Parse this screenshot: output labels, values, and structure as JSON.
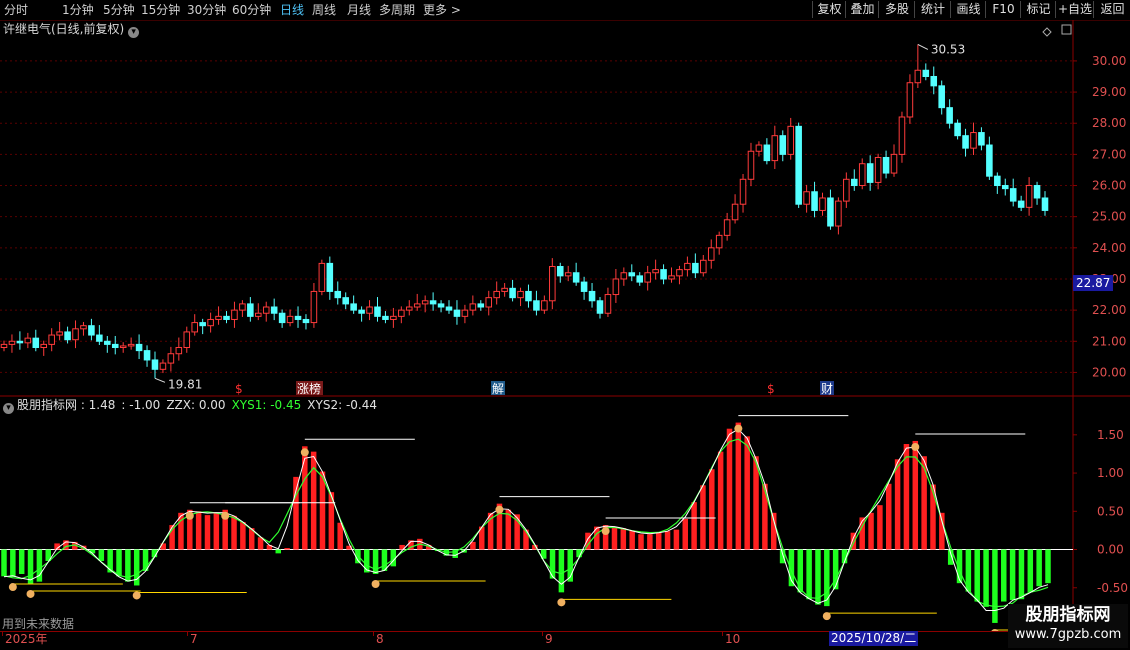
{
  "toolbar": {
    "periods": [
      "分时",
      "1分钟",
      "5分钟",
      "15分钟",
      "30分钟",
      "60分钟",
      "日线",
      "周线",
      "月线",
      "多周期",
      "更多 >"
    ],
    "active_period": "日线",
    "right_buttons": [
      "复权",
      "叠加",
      "多股",
      "统计",
      "画线",
      "F10",
      "标记",
      "+自选",
      "返回"
    ]
  },
  "main_chart": {
    "stock_title": "许继电气(日线,前复权)",
    "collapse_icon": "chevron-down-icon",
    "settings_icons": [
      "diamond-icon",
      "window-icon"
    ],
    "price_ticks": [
      "30.00",
      "29.00",
      "28.00",
      "27.00",
      "26.00",
      "25.00",
      "24.00",
      "23.00",
      "22.00",
      "21.00",
      "20.00"
    ],
    "current_price": "22.87",
    "high_marker": "30.53",
    "low_marker": "19.81",
    "event_markers": [
      {
        "label": "$",
        "color": "#ff3030"
      },
      {
        "label": "涨榜",
        "color": "#ffffff",
        "bg": "#7a1a1a"
      },
      {
        "label": "解",
        "color": "#ffffff",
        "bg": "#1e5a8a"
      },
      {
        "label": "$",
        "color": "#ff3030"
      },
      {
        "label": "财",
        "color": "#ffffff",
        "bg": "#1e3a8a"
      }
    ],
    "colors": {
      "up": "#ff3b3b",
      "down": "#54ffff",
      "grid": "#5a0000",
      "axis": "#8b0000"
    }
  },
  "chart_data": [
    {
      "type": "candlestick",
      "title": "许继电气(日线,前复权)",
      "ylim": [
        19.5,
        30.8
      ],
      "high": 30.53,
      "low": 19.81,
      "last": 25.2,
      "close_series": [
        20.9,
        21.0,
        20.95,
        21.1,
        20.8,
        20.9,
        21.2,
        21.3,
        21.05,
        21.4,
        21.5,
        21.2,
        21.0,
        20.9,
        20.8,
        20.85,
        20.9,
        20.7,
        20.4,
        20.1,
        20.3,
        20.6,
        20.8,
        21.3,
        21.6,
        21.5,
        21.7,
        21.8,
        21.7,
        22.0,
        22.2,
        21.8,
        21.9,
        22.1,
        21.9,
        21.6,
        21.8,
        21.7,
        21.6,
        22.6,
        23.5,
        22.6,
        22.4,
        22.2,
        22.0,
        21.9,
        22.1,
        21.8,
        21.7,
        21.8,
        22.0,
        22.1,
        22.2,
        22.3,
        22.2,
        22.1,
        22.0,
        21.8,
        22.0,
        22.2,
        22.1,
        22.4,
        22.6,
        22.7,
        22.4,
        22.6,
        22.3,
        22.0,
        22.3,
        23.4,
        23.1,
        23.2,
        22.9,
        22.6,
        22.3,
        21.9,
        22.5,
        23.0,
        23.2,
        23.1,
        22.9,
        23.2,
        23.3,
        23.0,
        23.1,
        23.3,
        23.5,
        23.2,
        23.6,
        24.0,
        24.4,
        24.9,
        25.4,
        26.2,
        27.1,
        27.3,
        26.8,
        27.6,
        27.0,
        27.9,
        25.4,
        25.8,
        25.2,
        25.6,
        24.7,
        25.5,
        26.2,
        26.0,
        26.7,
        26.1,
        26.9,
        26.4,
        27.0,
        28.2,
        29.3,
        29.7,
        29.5,
        29.2,
        28.5,
        28.0,
        27.6,
        27.2,
        27.7,
        27.3,
        26.3,
        26.0,
        25.9,
        25.5,
        25.3,
        26.0,
        25.6,
        25.2
      ]
    },
    {
      "type": "bar",
      "title": "股朋指标网",
      "indicator_values": [
        {
          "label": "股朋指标网 :",
          "value": "1.48"
        },
        {
          "label": ":",
          "value": "-1.00"
        },
        {
          "label": "ZZX:",
          "value": "0.00"
        },
        {
          "label": "XYS1:",
          "value": "-0.45"
        },
        {
          "label": "XYS2:",
          "value": "-0.44"
        }
      ],
      "ylim": [
        -1.0,
        1.72
      ],
      "y_ticks": [
        "1.50",
        "1.00",
        "0.50",
        "0.00",
        "-0.50"
      ],
      "colors": {
        "positive": "#ff2020",
        "negative": "#1eff1e",
        "xys1": "#ffffff",
        "xys2": "#30ff30"
      },
      "values": [
        -0.35,
        -0.36,
        -0.32,
        -0.45,
        -0.42,
        -0.15,
        0.08,
        0.12,
        0.1,
        0.05,
        -0.05,
        -0.15,
        -0.3,
        -0.35,
        -0.42,
        -0.47,
        -0.28,
        -0.1,
        0.08,
        0.32,
        0.48,
        0.52,
        0.5,
        0.45,
        0.48,
        0.52,
        0.44,
        0.36,
        0.28,
        0.16,
        0.06,
        -0.05,
        0.02,
        0.95,
        1.35,
        1.28,
        1.02,
        0.75,
        0.35,
        0.05,
        -0.18,
        -0.3,
        -0.32,
        -0.28,
        -0.22,
        0.06,
        0.12,
        0.14,
        0.06,
        -0.02,
        -0.08,
        -0.11,
        -0.04,
        0.1,
        0.3,
        0.48,
        0.6,
        0.52,
        0.46,
        0.26,
        0.06,
        -0.12,
        -0.38,
        -0.56,
        -0.42,
        -0.1,
        0.22,
        0.3,
        0.32,
        0.3,
        0.28,
        0.25,
        0.2,
        0.2,
        0.22,
        0.24,
        0.26,
        0.4,
        0.62,
        0.84,
        1.05,
        1.28,
        1.58,
        1.66,
        1.48,
        1.22,
        0.86,
        0.48,
        -0.18,
        -0.48,
        -0.56,
        -0.65,
        -0.72,
        -0.74,
        -0.52,
        -0.18,
        0.22,
        0.42,
        0.48,
        0.58,
        0.86,
        1.18,
        1.38,
        1.42,
        1.22,
        0.85,
        0.48,
        -0.2,
        -0.44,
        -0.55,
        -0.68,
        -0.75,
        -0.96,
        -0.68,
        -0.66,
        -0.65,
        -0.56,
        -0.48,
        -0.44
      ]
    }
  ],
  "indicator": {
    "future_note": "用到未来数据"
  },
  "watermark": {
    "line1": "股朋指标网",
    "line2": "www.7gpzb.com"
  },
  "dates": {
    "labels": [
      "2025年",
      "7",
      "8",
      "9",
      "10"
    ],
    "current": "2025/10/28/二"
  }
}
